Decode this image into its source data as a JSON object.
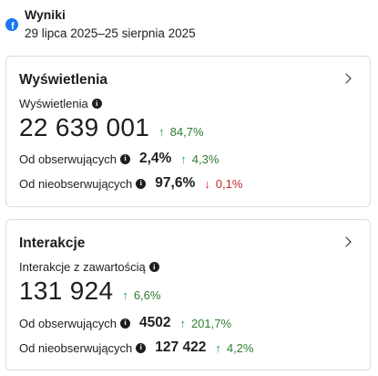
{
  "header": {
    "title": "Wyniki",
    "date_range": "29 lipca 2025–25 sierpnia 2025",
    "icon": "facebook-icon",
    "icon_glyph": "f"
  },
  "views": {
    "title": "Wyświetlenia",
    "metric_label": "Wyświetlenia",
    "value": "22 639 001",
    "change": "84,7%",
    "change_dir": "up",
    "followers_label": "Od obserwujących",
    "followers_value": "2,4%",
    "followers_change": "4,3%",
    "followers_change_dir": "up",
    "nonfollowers_label": "Od nieobserwujących",
    "nonfollowers_value": "97,6%",
    "nonfollowers_change": "0,1%",
    "nonfollowers_change_dir": "down"
  },
  "interactions": {
    "title": "Interakcje",
    "metric_label": "Interakcje z zawartością",
    "value": "131 924",
    "change": "6,6%",
    "change_dir": "up",
    "followers_label": "Od obserwujących",
    "followers_value": "4502",
    "followers_change": "201,7%",
    "followers_change_dir": "up",
    "nonfollowers_label": "Od nieobserwujących",
    "nonfollowers_value": "127 422",
    "nonfollowers_change": "4,2%",
    "nonfollowers_change_dir": "up"
  },
  "glyphs": {
    "up_arrow": "↑",
    "down_arrow": "↓",
    "info": "i"
  },
  "colors": {
    "up": "#31a24c",
    "down": "#e41e3f",
    "brand": "#1877f2",
    "border": "#dadde1"
  }
}
